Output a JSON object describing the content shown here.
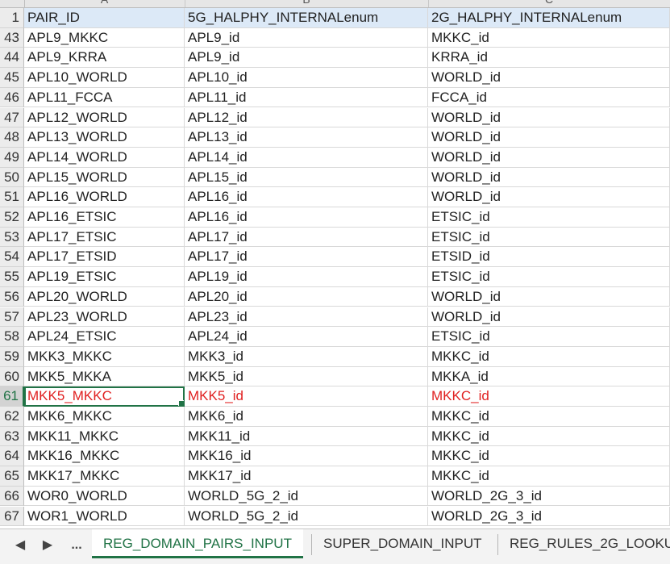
{
  "column_headers": [
    "A",
    "B",
    "C"
  ],
  "header_row": {
    "num": "1",
    "a": "PAIR_ID",
    "b": "5G_HALPHY_INTERNALenum",
    "c": "2G_HALPHY_INTERNALenum"
  },
  "rows": [
    {
      "num": "43",
      "a": "APL9_MKKC",
      "b": "APL9_id",
      "c": "MKKC_id"
    },
    {
      "num": "44",
      "a": "APL9_KRRA",
      "b": "APL9_id",
      "c": "KRRA_id"
    },
    {
      "num": "45",
      "a": "APL10_WORLD",
      "b": "APL10_id",
      "c": "WORLD_id"
    },
    {
      "num": "46",
      "a": "APL11_FCCA",
      "b": "APL11_id",
      "c": "FCCA_id"
    },
    {
      "num": "47",
      "a": "APL12_WORLD",
      "b": "APL12_id",
      "c": "WORLD_id"
    },
    {
      "num": "48",
      "a": "APL13_WORLD",
      "b": "APL13_id",
      "c": "WORLD_id"
    },
    {
      "num": "49",
      "a": "APL14_WORLD",
      "b": "APL14_id",
      "c": "WORLD_id"
    },
    {
      "num": "50",
      "a": "APL15_WORLD",
      "b": "APL15_id",
      "c": "WORLD_id"
    },
    {
      "num": "51",
      "a": "APL16_WORLD",
      "b": "APL16_id",
      "c": "WORLD_id"
    },
    {
      "num": "52",
      "a": "APL16_ETSIC",
      "b": "APL16_id",
      "c": "ETSIC_id"
    },
    {
      "num": "53",
      "a": "APL17_ETSIC",
      "b": "APL17_id",
      "c": "ETSIC_id"
    },
    {
      "num": "54",
      "a": "APL17_ETSID",
      "b": "APL17_id",
      "c": "ETSID_id"
    },
    {
      "num": "55",
      "a": "APL19_ETSIC",
      "b": "APL19_id",
      "c": "ETSIC_id"
    },
    {
      "num": "56",
      "a": "APL20_WORLD",
      "b": "APL20_id",
      "c": "WORLD_id"
    },
    {
      "num": "57",
      "a": "APL23_WORLD",
      "b": "APL23_id",
      "c": "WORLD_id"
    },
    {
      "num": "58",
      "a": "APL24_ETSIC",
      "b": "APL24_id",
      "c": "ETSIC_id"
    },
    {
      "num": "59",
      "a": "MKK3_MKKC",
      "b": "MKK3_id",
      "c": "MKKC_id"
    },
    {
      "num": "60",
      "a": "MKK5_MKKA",
      "b": "MKK5_id",
      "c": "MKKA_id"
    },
    {
      "num": "61",
      "a": "MKK5_MKKC",
      "b": "MKK5_id",
      "c": "MKKC_id"
    },
    {
      "num": "62",
      "a": "MKK6_MKKC",
      "b": "MKK6_id",
      "c": "MKKC_id"
    },
    {
      "num": "63",
      "a": "MKK11_MKKC",
      "b": "MKK11_id",
      "c": "MKKC_id"
    },
    {
      "num": "64",
      "a": "MKK16_MKKC",
      "b": "MKK16_id",
      "c": "MKKC_id"
    },
    {
      "num": "65",
      "a": "MKK17_MKKC",
      "b": "MKK17_id",
      "c": "MKKC_id"
    },
    {
      "num": "66",
      "a": "WOR0_WORLD",
      "b": "WORLD_5G_2_id",
      "c": "WORLD_2G_3_id"
    },
    {
      "num": "67",
      "a": "WOR1_WORLD",
      "b": "WORLD_5G_2_id",
      "c": "WORLD_2G_3_id"
    }
  ],
  "active_row_num": "61",
  "tabs": {
    "nav_prev": "◀",
    "nav_next": "▶",
    "more": "...",
    "items": [
      "REG_DOMAIN_PAIRS_INPUT",
      "SUPER_DOMAIN_INPUT",
      "REG_RULES_2G_LOOKU"
    ]
  },
  "colors": {
    "accent": "#217346",
    "highlight_text": "#e02020",
    "header_fill": "#dce9f7"
  }
}
